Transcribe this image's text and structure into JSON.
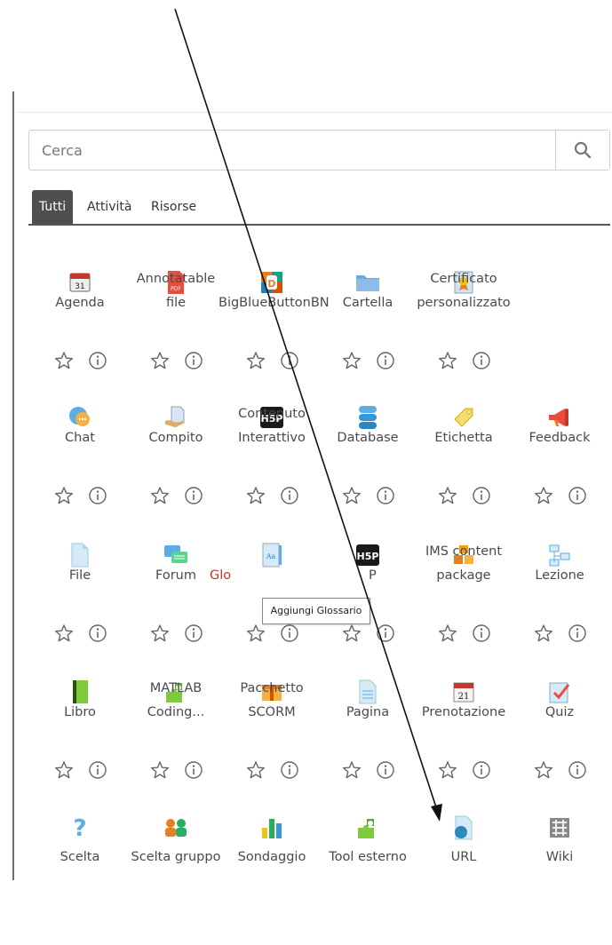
{
  "search": {
    "placeholder": "Cerca"
  },
  "tabs": [
    {
      "label": "Tutti",
      "active": true
    },
    {
      "label": "Attività",
      "active": false
    },
    {
      "label": "Risorse",
      "active": false
    }
  ],
  "tooltip": {
    "text": "Aggiungi Glossario"
  },
  "modules": [
    {
      "label": "Agenda",
      "icon": "calendar-icon"
    },
    {
      "label": "Annotatable\nfile",
      "icon": "pdf-icon"
    },
    {
      "label": "BigBlueButtonBN",
      "icon": "bigbluebutton-icon"
    },
    {
      "label": "Cartella",
      "icon": "folder-icon"
    },
    {
      "label": "Certificato\npersonalizzato",
      "icon": "certificate-icon"
    },
    {
      "label": "Chat",
      "icon": "chat-icon"
    },
    {
      "label": "Compito",
      "icon": "assignment-icon"
    },
    {
      "label": "Contenuto\nInterattivo",
      "icon": "h5p-icon"
    },
    {
      "label": "Database",
      "icon": "database-icon"
    },
    {
      "label": "Etichetta",
      "icon": "label-tag-icon"
    },
    {
      "label": "Feedback",
      "icon": "megaphone-icon"
    },
    {
      "label": "File",
      "icon": "file-icon"
    },
    {
      "label": "Forum",
      "icon": "forum-icon"
    },
    {
      "label": "Glo",
      "icon": "glossary-icon"
    },
    {
      "label": "P",
      "icon": "h5p-icon"
    },
    {
      "label": "IMS content\npackage",
      "icon": "ims-package-icon"
    },
    {
      "label": "Lezione",
      "icon": "lesson-icon"
    },
    {
      "label": "Libro",
      "icon": "book-icon"
    },
    {
      "label": "MATLAB\nCoding...",
      "icon": "puzzle-icon"
    },
    {
      "label": "Pacchetto\nSCORM",
      "icon": "scorm-icon"
    },
    {
      "label": "Pagina",
      "icon": "page-icon"
    },
    {
      "label": "Prenotazione",
      "icon": "calendar-21-icon"
    },
    {
      "label": "Quiz",
      "icon": "quiz-icon"
    },
    {
      "label": "Scelta",
      "icon": "question-icon"
    },
    {
      "label": "Scelta gruppo",
      "icon": "group-choice-icon"
    },
    {
      "label": "Sondaggio",
      "icon": "survey-chart-icon"
    },
    {
      "label": "Tool esterno",
      "icon": "puzzle-icon"
    },
    {
      "label": "URL",
      "icon": "url-globe-icon"
    },
    {
      "label": "Wiki",
      "icon": "wiki-icon"
    }
  ],
  "colors": {
    "accent_text": "#c0392b",
    "tab_active_bg": "#4f4f4f"
  }
}
